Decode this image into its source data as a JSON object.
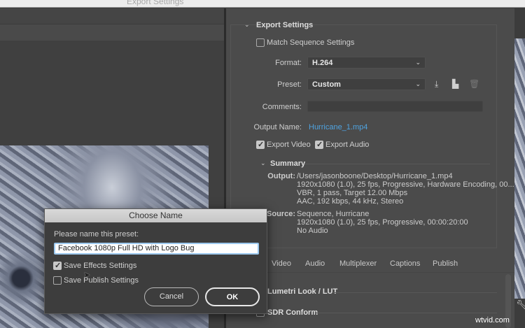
{
  "window": {
    "title": "Export Settings"
  },
  "export_settings": {
    "section_title": "Export Settings",
    "match_sequence_label": "Match Sequence Settings",
    "match_sequence_checked": false,
    "format_label": "Format:",
    "format_value": "H.264",
    "preset_label": "Preset:",
    "preset_value": "Custom",
    "comments_label": "Comments:",
    "comments_value": "",
    "output_name_label": "Output Name:",
    "output_name_value": "Hurricane_1.mp4",
    "export_video_label": "Export Video",
    "export_video_checked": true,
    "export_audio_label": "Export Audio",
    "export_audio_checked": true
  },
  "summary": {
    "title": "Summary",
    "output_key": "Output:",
    "output_lines": [
      "/Users/jasonboone/Desktop/Hurricane_1.mp4",
      "1920x1080 (1.0), 25 fps, Progressive, Hardware Encoding, 00...",
      "VBR, 1 pass, Target 12.00 Mbps",
      "AAC, 192 kbps, 44 kHz, Stereo"
    ],
    "source_key": "Source:",
    "source_lines": [
      "Sequence, Hurricane",
      "1920x1080 (1.0), 25 fps, Progressive, 00:00:20:00",
      "No Audio"
    ]
  },
  "tabs": [
    "Video",
    "Audio",
    "Multiplexer",
    "Captions",
    "Publish"
  ],
  "effects": {
    "lumetri_label": "Lumetri Look / LUT",
    "sdr_label": "SDR Conform"
  },
  "dialog": {
    "title": "Choose Name",
    "prompt": "Please name this preset:",
    "name_value": "Facebook 1080p Full HD with Logo Bug",
    "save_effects_label": "Save Effects Settings",
    "save_effects_checked": true,
    "save_publish_label": "Save Publish Settings",
    "save_publish_checked": false,
    "cancel_label": "Cancel",
    "ok_label": "OK"
  },
  "watermark": "wtvid.com"
}
